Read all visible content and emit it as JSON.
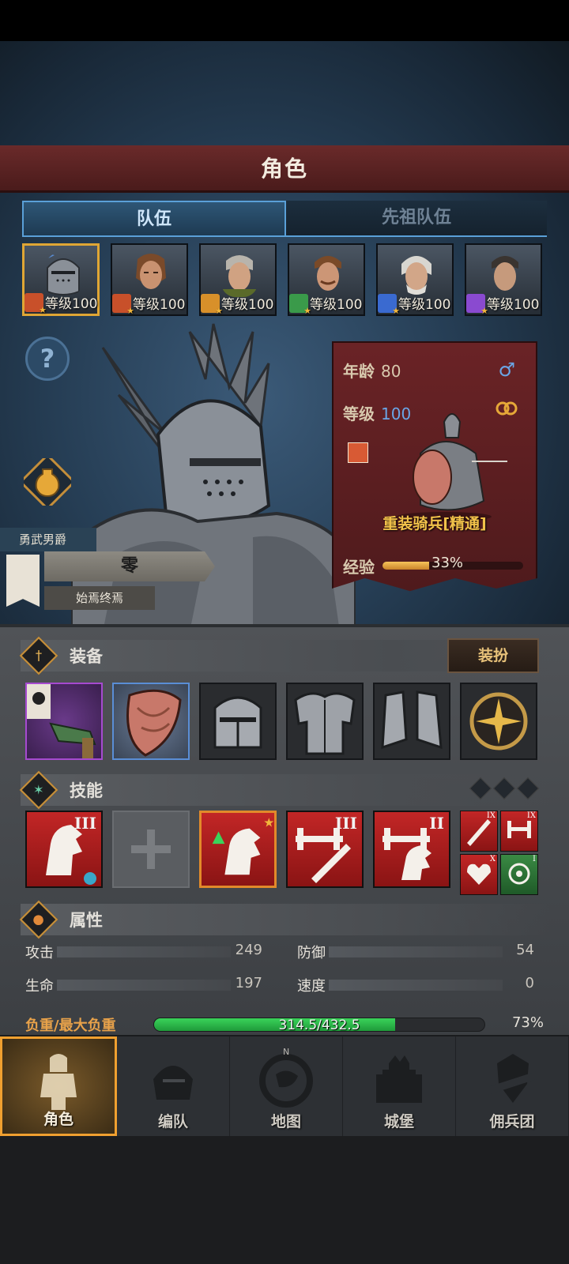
{
  "header": {
    "title": "角色"
  },
  "tabs": [
    {
      "label": "队伍",
      "active": true
    },
    {
      "label": "先祖队伍",
      "active": false
    }
  ],
  "party": [
    {
      "level_text": "等级100",
      "class_color": "#c8502a",
      "selected": true
    },
    {
      "level_text": "等级100",
      "class_color": "#c8502a",
      "selected": false
    },
    {
      "level_text": "等级100",
      "class_color": "#d8902a",
      "selected": false
    },
    {
      "level_text": "等级100",
      "class_color": "#3a9a4a",
      "selected": false
    },
    {
      "level_text": "等级100",
      "class_color": "#3a6ad0",
      "selected": false
    },
    {
      "level_text": "等级100",
      "class_color": "#8a4ad0",
      "selected": false
    }
  ],
  "character": {
    "title_tag": "勇武男爵",
    "name": "零",
    "motto": "始焉终焉"
  },
  "info": {
    "age_label": "年龄",
    "age_value": "80",
    "gender_icon": "♂",
    "level_label": "等级",
    "level_value": "100",
    "unit_name": "重装骑兵[精通]",
    "exp_label": "经验",
    "exp_fraction": 0.33,
    "exp_pct": "33%"
  },
  "equipment": {
    "title": "装备",
    "dress_button": "装扮"
  },
  "skills": {
    "title": "技能",
    "slots": [
      {
        "type": "horse",
        "rank": "III",
        "badge": "3"
      },
      {
        "type": "empty",
        "rank": ""
      },
      {
        "type": "horse-up",
        "rank": ""
      },
      {
        "type": "sword",
        "rank": "III"
      },
      {
        "type": "horse",
        "rank": "II"
      }
    ],
    "mini": [
      {
        "type": "sword",
        "rank": "IX"
      },
      {
        "type": "weight",
        "rank": "IX"
      },
      {
        "type": "heart",
        "rank": "X"
      },
      {
        "type": "target",
        "rank": "I"
      }
    ]
  },
  "attributes": {
    "title": "属性",
    "attack_label": "攻击",
    "attack_value": "249",
    "defense_label": "防御",
    "defense_value": "54",
    "hp_label": "生命",
    "hp_value": "197",
    "speed_label": "速度",
    "speed_value": "0",
    "load_label": "负重/最大负重",
    "load_value": "314.5/432.5",
    "load_fraction": 0.73,
    "load_pct": "73%"
  },
  "nav": [
    {
      "label": "角色",
      "active": true,
      "icon": "knight-icon"
    },
    {
      "label": "编队",
      "active": false,
      "icon": "helmet-icon"
    },
    {
      "label": "地图",
      "active": false,
      "icon": "compass-map-icon"
    },
    {
      "label": "城堡",
      "active": false,
      "icon": "castle-icon"
    },
    {
      "label": "佣兵团",
      "active": false,
      "icon": "mercenary-icon"
    }
  ]
}
